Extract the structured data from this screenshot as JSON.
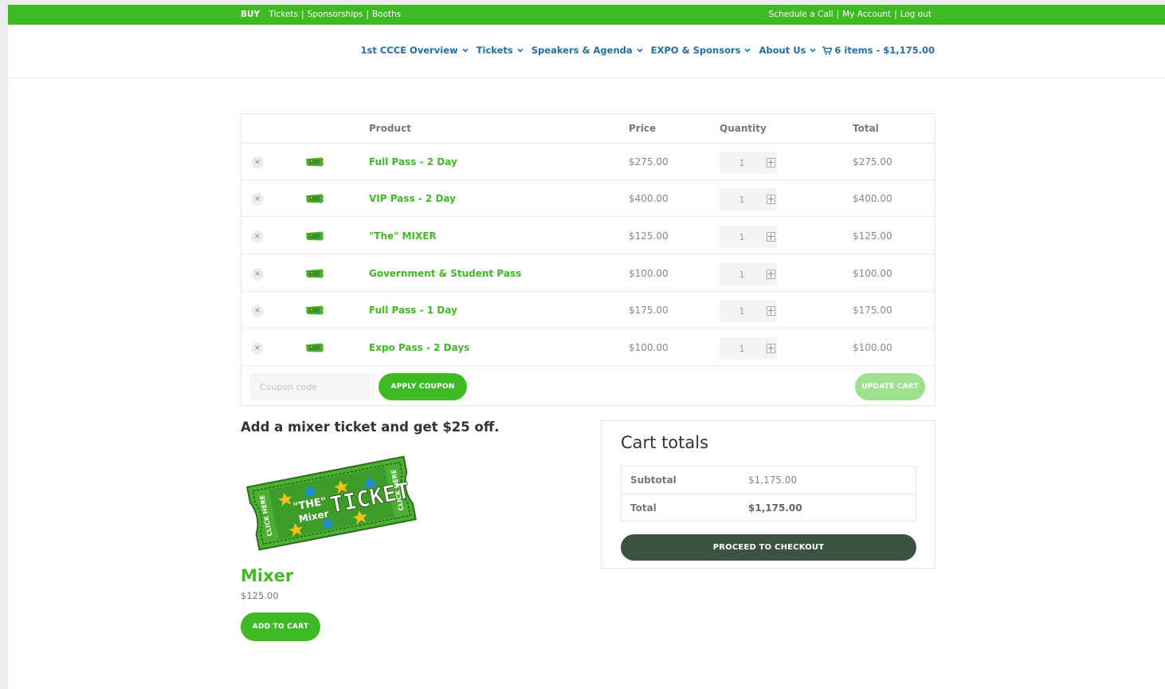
{
  "topbar": {
    "buy_label": "BUY",
    "left_links": [
      "Tickets",
      "Sponsorships",
      "Booths"
    ],
    "right_links": [
      "Schedule a Call",
      "My Account",
      "Log out"
    ],
    "separator": "|"
  },
  "nav": {
    "items": [
      {
        "label": "1st CCCE Overview"
      },
      {
        "label": "Tickets"
      },
      {
        "label": "Speakers & Agenda"
      },
      {
        "label": "EXPO & Sponsors"
      },
      {
        "label": "About Us"
      }
    ],
    "cart_label": "6 items - $1,175.00"
  },
  "cart": {
    "headers": {
      "product": "Product",
      "price": "Price",
      "quantity": "Quantity",
      "total": "Total"
    },
    "items": [
      {
        "name": "Full Pass - 2 Day",
        "price": "$275.00",
        "qty": "1",
        "total": "$275.00"
      },
      {
        "name": "VIP Pass - 2 Day",
        "price": "$400.00",
        "qty": "1",
        "total": "$400.00"
      },
      {
        "name": "\"The\" MIXER",
        "price": "$125.00",
        "qty": "1",
        "total": "$125.00"
      },
      {
        "name": "Government & Student Pass",
        "price": "$100.00",
        "qty": "1",
        "total": "$100.00"
      },
      {
        "name": "Full Pass - 1 Day",
        "price": "$175.00",
        "qty": "1",
        "total": "$175.00"
      },
      {
        "name": "Expo Pass - 2 Days",
        "price": "$100.00",
        "qty": "1",
        "total": "$100.00"
      }
    ],
    "remove_symbol": "×",
    "coupon_placeholder": "Coupon code",
    "apply_label": "APPLY COUPON",
    "update_label": "UPDATE CART"
  },
  "promo": {
    "title": "Add a mixer ticket and get $25 off.",
    "ticket_image": {
      "line1": "\"THE\"",
      "line2": "Mixer",
      "big": "TICKET",
      "side": "CLICK HERE"
    },
    "product_name": "Mixer",
    "product_price": "$125.00",
    "add_label": "ADD TO CART"
  },
  "totals": {
    "title": "Cart totals",
    "subtotal_label": "Subtotal",
    "subtotal_value": "$1,175.00",
    "total_label": "Total",
    "total_value": "$1,175.00",
    "checkout_label": "PROCEED TO CHECKOUT"
  },
  "colors": {
    "brand_green": "#3fba24",
    "nav_blue": "#1f6fa8",
    "checkout_dark": "#3b5241",
    "update_light_green": "#9ee08d"
  }
}
